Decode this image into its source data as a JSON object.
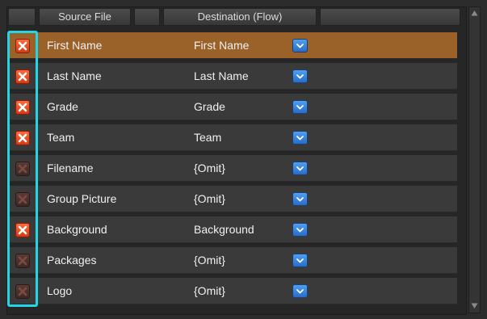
{
  "header": {
    "source_label": "Source File",
    "destination_label": "Destination (Flow)"
  },
  "rows": [
    {
      "source": "First Name",
      "destination": "First Name",
      "enabled": true,
      "selected": true
    },
    {
      "source": "Last Name",
      "destination": "Last Name",
      "enabled": true,
      "selected": false
    },
    {
      "source": "Grade",
      "destination": "Grade",
      "enabled": true,
      "selected": false
    },
    {
      "source": "Team",
      "destination": "Team",
      "enabled": true,
      "selected": false
    },
    {
      "source": "Filename",
      "destination": "{Omit}",
      "enabled": false,
      "selected": false
    },
    {
      "source": "Group Picture",
      "destination": "{Omit}",
      "enabled": false,
      "selected": false
    },
    {
      "source": "Background",
      "destination": "Background",
      "enabled": true,
      "selected": false
    },
    {
      "source": "Packages",
      "destination": "{Omit}",
      "enabled": false,
      "selected": false
    },
    {
      "source": "Logo",
      "destination": "{Omit}",
      "enabled": false,
      "selected": false
    }
  ],
  "icons": {
    "remove": "close-x-icon",
    "dropdown": "chevron-down-icon",
    "scroll_up": "arrow-up-icon",
    "scroll_down": "arrow-down-icon"
  },
  "colors": {
    "selected_row": "#9a6128",
    "row": "#3a3a3a",
    "highlight_outline": "#22d6e6",
    "remove_active": "#e8471e",
    "dropdown": "#3b86dc"
  }
}
